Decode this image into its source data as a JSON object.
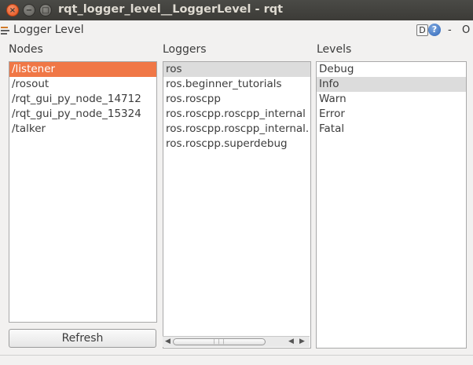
{
  "window": {
    "title": "rqt_logger_level__LoggerLevel - rqt",
    "close_glyph": "×",
    "min_glyph": "−",
    "max_glyph": "□"
  },
  "dock": {
    "title": "Logger Level",
    "d_label": "D",
    "help_label": "?",
    "minus_label": "-",
    "close_label": "O"
  },
  "nodes": {
    "header": "Nodes",
    "items": [
      "/listener",
      "/rosout",
      "/rqt_gui_py_node_14712",
      "/rqt_gui_py_node_15324",
      "/talker"
    ],
    "selected_index": 0,
    "refresh_label": "Refresh"
  },
  "loggers": {
    "header": "Loggers",
    "items": [
      "ros",
      "ros.beginner_tutorials",
      "ros.roscpp",
      "ros.roscpp.roscpp_internal",
      "ros.roscpp.roscpp_internal.",
      "ros.roscpp.superdebug"
    ],
    "selected_index": 0
  },
  "levels": {
    "header": "Levels",
    "items": [
      "Debug",
      "Info",
      "Warn",
      "Error",
      "Fatal"
    ],
    "selected_index": 1
  },
  "colors": {
    "accent_selection": "#f07746",
    "neutral_selection": "#dcdcdc",
    "titlebar": "#3c3b37"
  }
}
